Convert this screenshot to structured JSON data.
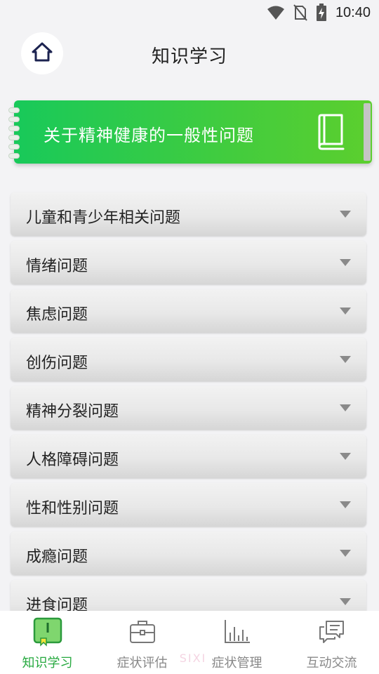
{
  "status_bar": {
    "time": "10:40",
    "icons": [
      "wifi-icon",
      "no-sim-icon",
      "battery-charging-icon"
    ]
  },
  "header": {
    "title": "知识学习",
    "home_icon": "home-icon"
  },
  "banner": {
    "label": "关于精神健康的一般性问题",
    "icon": "book-icon",
    "color_start": "#18c95a",
    "color_end": "#5ccf2e"
  },
  "accordion": [
    {
      "label": "儿童和青少年相关问题"
    },
    {
      "label": "情绪问题"
    },
    {
      "label": "焦虑问题"
    },
    {
      "label": "创伤问题"
    },
    {
      "label": "精神分裂问题"
    },
    {
      "label": "人格障碍问题"
    },
    {
      "label": "性和性别问题"
    },
    {
      "label": "成瘾问题"
    },
    {
      "label": "进食问题"
    }
  ],
  "bottom_nav": [
    {
      "label": "知识学习",
      "icon": "knowledge-book-icon",
      "active": true
    },
    {
      "label": "症状评估",
      "icon": "briefcase-icon",
      "active": false
    },
    {
      "label": "症状管理",
      "icon": "bar-chart-icon",
      "active": false
    },
    {
      "label": "互动交流",
      "icon": "chat-bubbles-icon",
      "active": false
    }
  ],
  "watermark": "SIXI",
  "colors": {
    "accent_green": "#26a93f",
    "background": "#f3f3f5"
  }
}
